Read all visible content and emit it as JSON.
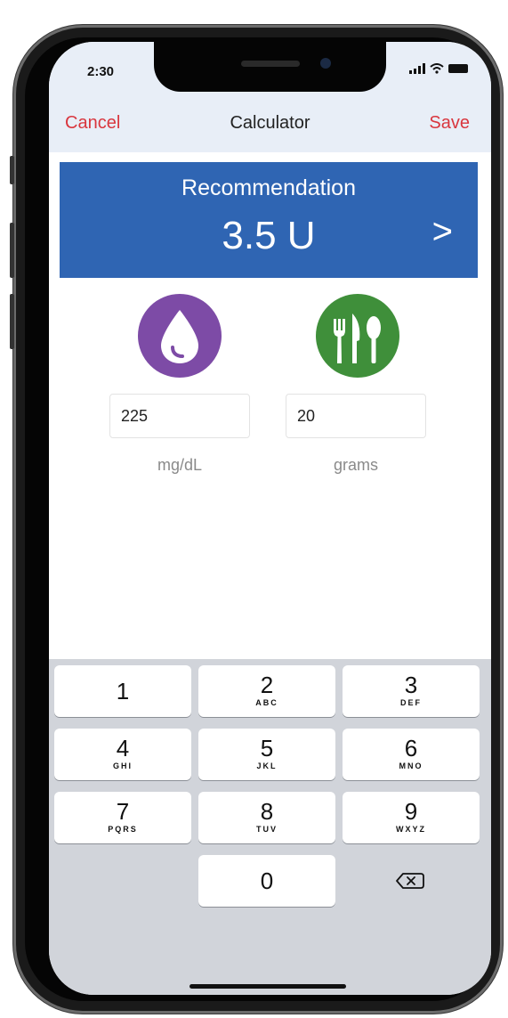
{
  "status_bar": {
    "time": "2:30"
  },
  "nav": {
    "cancel": "Cancel",
    "title": "Calculator",
    "save": "Save"
  },
  "recommendation": {
    "label": "Recommendation",
    "value": "3.5 U",
    "arrow": ">"
  },
  "glucose": {
    "icon": "blood-drop-icon",
    "value": "225",
    "unit": "mg/dL",
    "color": "#7d4ba6"
  },
  "carbs": {
    "icon": "fork-knife-spoon-icon",
    "value": "20",
    "unit": "grams",
    "color": "#3f8f3a"
  },
  "keypad": {
    "k1": {
      "digit": "1"
    },
    "k2": {
      "digit": "2",
      "letters": "ABC"
    },
    "k3": {
      "digit": "3",
      "letters": "DEF"
    },
    "k4": {
      "digit": "4",
      "letters": "GHI"
    },
    "k5": {
      "digit": "5",
      "letters": "JKL"
    },
    "k6": {
      "digit": "6",
      "letters": "MNO"
    },
    "k7": {
      "digit": "7",
      "letters": "PQRS"
    },
    "k8": {
      "digit": "8",
      "letters": "TUV"
    },
    "k9": {
      "digit": "9",
      "letters": "WXYZ"
    },
    "k0": {
      "digit": "0"
    },
    "backspace": "backspace-icon"
  },
  "colors": {
    "accent_red": "#d9363e",
    "banner_blue": "#2f65b3",
    "header_bg": "#e8eef7"
  }
}
